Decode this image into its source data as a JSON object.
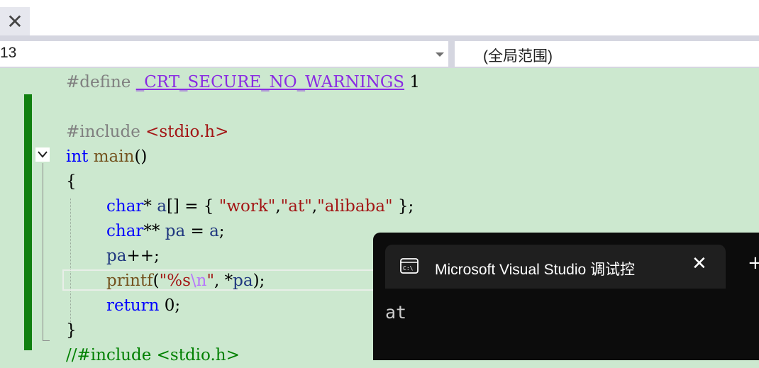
{
  "tabstrip": {
    "close_glyph": "✕"
  },
  "navbar": {
    "project_value": "13",
    "scope_value": "(全局范围)"
  },
  "editor": {
    "lines": {
      "l1": {
        "pp": "#define ",
        "mac": "_CRT_SECURE_NO_WARNINGS",
        "rest": " 1"
      },
      "l3": {
        "pp": "#include ",
        "s": "<stdio.h>"
      },
      "l4": {
        "kw": "int",
        "fn": " main",
        "rest": "()"
      },
      "l5": "{",
      "l6": {
        "kw": "char",
        "a": "* ",
        "var": "a",
        "b": "[] = { ",
        "s1": "\"work\"",
        "c1": ",",
        "s2": "\"at\"",
        "c2": ",",
        "s3": "\"alibaba\"",
        "e": " };"
      },
      "l7": {
        "kw": "char",
        "a": "** ",
        "var1": "pa",
        "b": " = ",
        "var2": "a",
        "e": ";"
      },
      "l8": {
        "var": "pa",
        "e": "++;"
      },
      "l9": {
        "fn": "printf",
        "a": "(",
        "s1": "\"%s",
        "esc": "\\n",
        "s2": "\"",
        "b": ", *",
        "var": "pa",
        "e": ");"
      },
      "l10": {
        "kw": "return",
        "e": " 0;"
      },
      "l11": "}",
      "l12": "//#include <stdio.h>"
    }
  },
  "terminal": {
    "title": "Microsoft Visual Studio 调试控",
    "close_glyph": "✕",
    "plus_glyph": "+",
    "output": "at"
  },
  "colors": {
    "editor_bg": "#cce8cf",
    "keyword": "#0000ff",
    "string": "#a31515",
    "macro": "#8a2be2",
    "preprocessor": "#808080",
    "change_bar": "#108010",
    "terminal_bg": "#0c0c0c"
  }
}
